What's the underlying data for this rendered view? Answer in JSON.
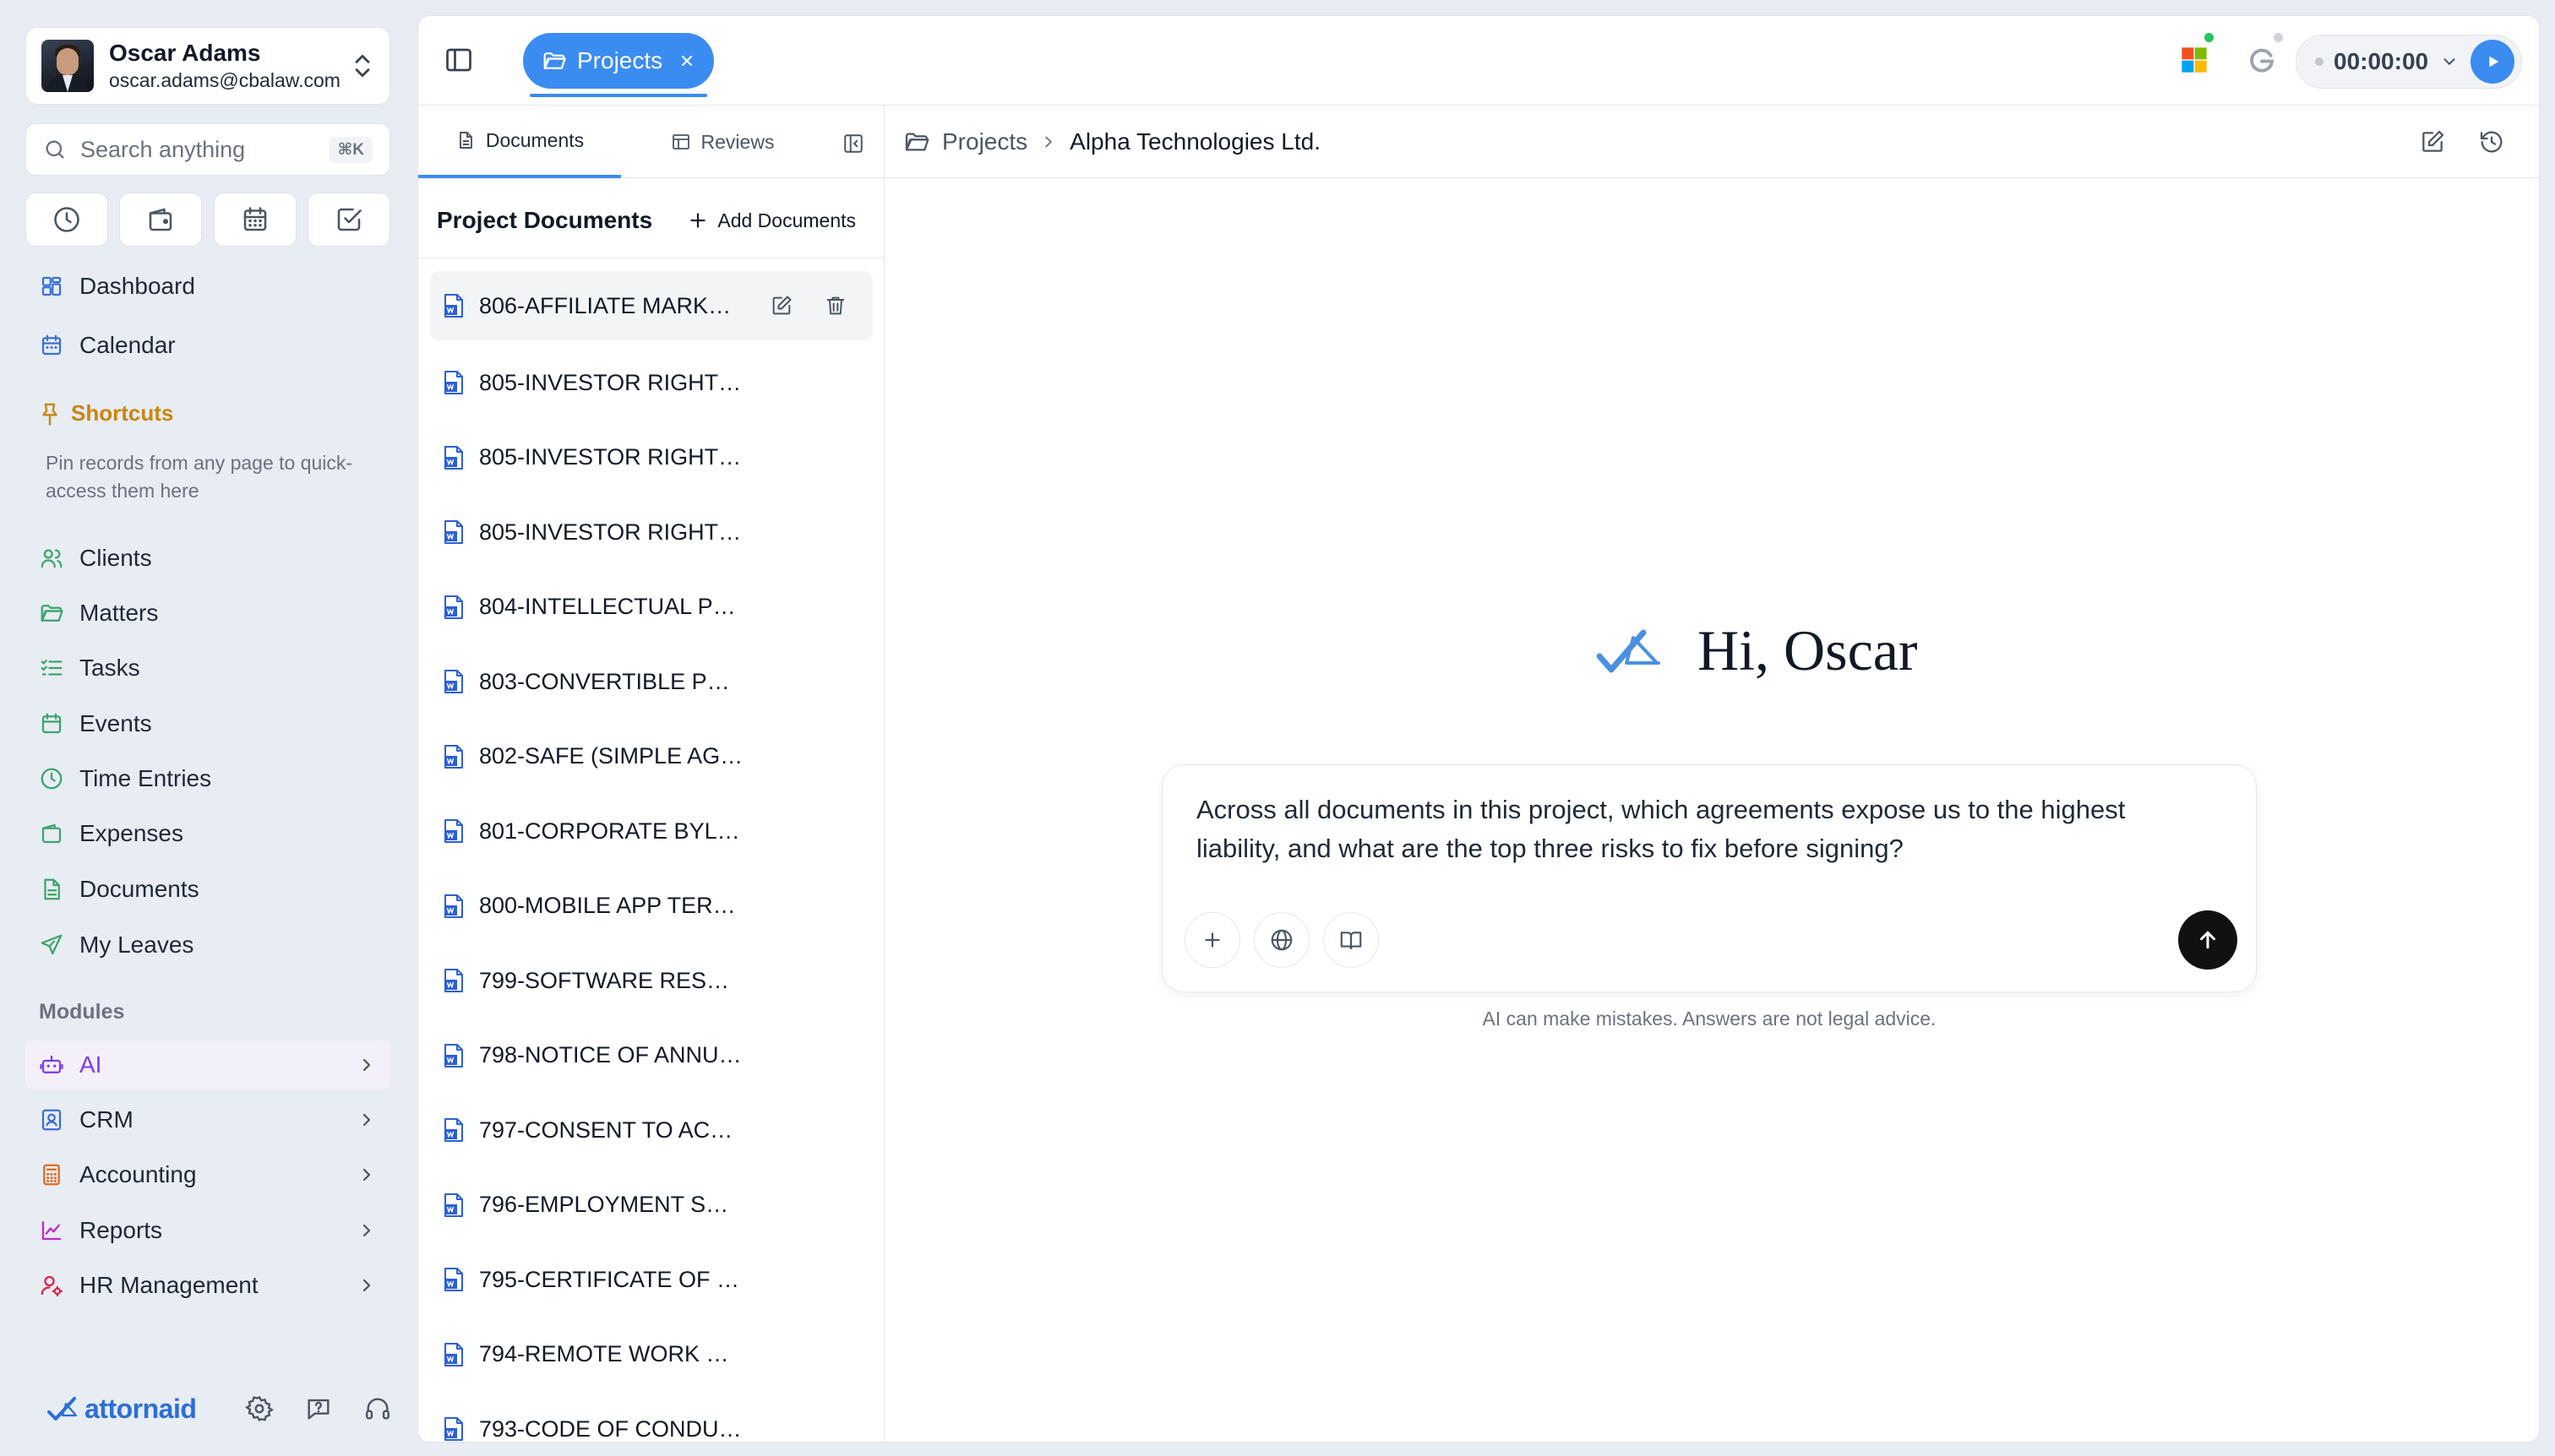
{
  "user": {
    "name": "Oscar Adams",
    "email": "oscar.adams@cbalaw.com"
  },
  "search": {
    "placeholder": "Search anything",
    "shortcut": "⌘K"
  },
  "quick_actions": [
    "clock-icon",
    "wallet-icon",
    "calendar-icon",
    "check-square-icon"
  ],
  "nav": {
    "top": [
      {
        "label": "Dashboard",
        "icon": "dashboard-icon"
      },
      {
        "label": "Calendar",
        "icon": "calendar-icon"
      }
    ],
    "shortcuts": {
      "title": "Shortcuts",
      "hint": "Pin records from any page to quick-access them here"
    },
    "main": [
      {
        "label": "Clients",
        "icon": "users-icon"
      },
      {
        "label": "Matters",
        "icon": "folder-icon"
      },
      {
        "label": "Tasks",
        "icon": "list-check-icon"
      },
      {
        "label": "Events",
        "icon": "calendar-icon"
      },
      {
        "label": "Time Entries",
        "icon": "clock-icon"
      },
      {
        "label": "Expenses",
        "icon": "wallet-icon"
      },
      {
        "label": "Documents",
        "icon": "file-icon"
      },
      {
        "label": "My Leaves",
        "icon": "plane-icon"
      }
    ],
    "modules_title": "Modules",
    "modules": [
      {
        "label": "AI",
        "icon": "robot-icon",
        "active": true
      },
      {
        "label": "CRM",
        "icon": "contact-icon"
      },
      {
        "label": "Accounting",
        "icon": "calculator-icon"
      },
      {
        "label": "Reports",
        "icon": "chart-icon"
      },
      {
        "label": "HR Management",
        "icon": "user-gear-icon"
      }
    ]
  },
  "footer": {
    "logo": "attornaid"
  },
  "topbar": {
    "tab_label": "Projects",
    "timer": "00:00:00"
  },
  "doc_panel": {
    "tabs": [
      "Documents",
      "Reviews"
    ],
    "title": "Project Documents",
    "add_label": "Add Documents",
    "documents": [
      "806-AFFILIATE MARK…",
      "805-INVESTOR RIGHT…",
      "805-INVESTOR RIGHT…",
      "805-INVESTOR RIGHT…",
      "804-INTELLECTUAL P…",
      "803-CONVERTIBLE P…",
      "802-SAFE (SIMPLE AG…",
      "801-CORPORATE BYL…",
      "800-MOBILE APP TER…",
      "799-SOFTWARE RES…",
      "798-NOTICE OF ANNU…",
      "797-CONSENT TO AC…",
      "796-EMPLOYMENT S…",
      "795-CERTIFICATE OF …",
      "794-REMOTE WORK …",
      "793-CODE OF CONDU…"
    ]
  },
  "breadcrumb": {
    "root": "Projects",
    "current": "Alpha Technologies Ltd."
  },
  "chat": {
    "greeting": "Hi, Oscar",
    "prompt": "Across all documents in this project, which agreements expose us to the highest liability, and what are the top three risks to fix before signing?",
    "disclaimer": "AI can make mistakes. Answers are not legal advice."
  },
  "colors": {
    "accent": "#3b8cf0",
    "ai_active": "#7c3aed",
    "shortcuts": "#c7860f"
  }
}
